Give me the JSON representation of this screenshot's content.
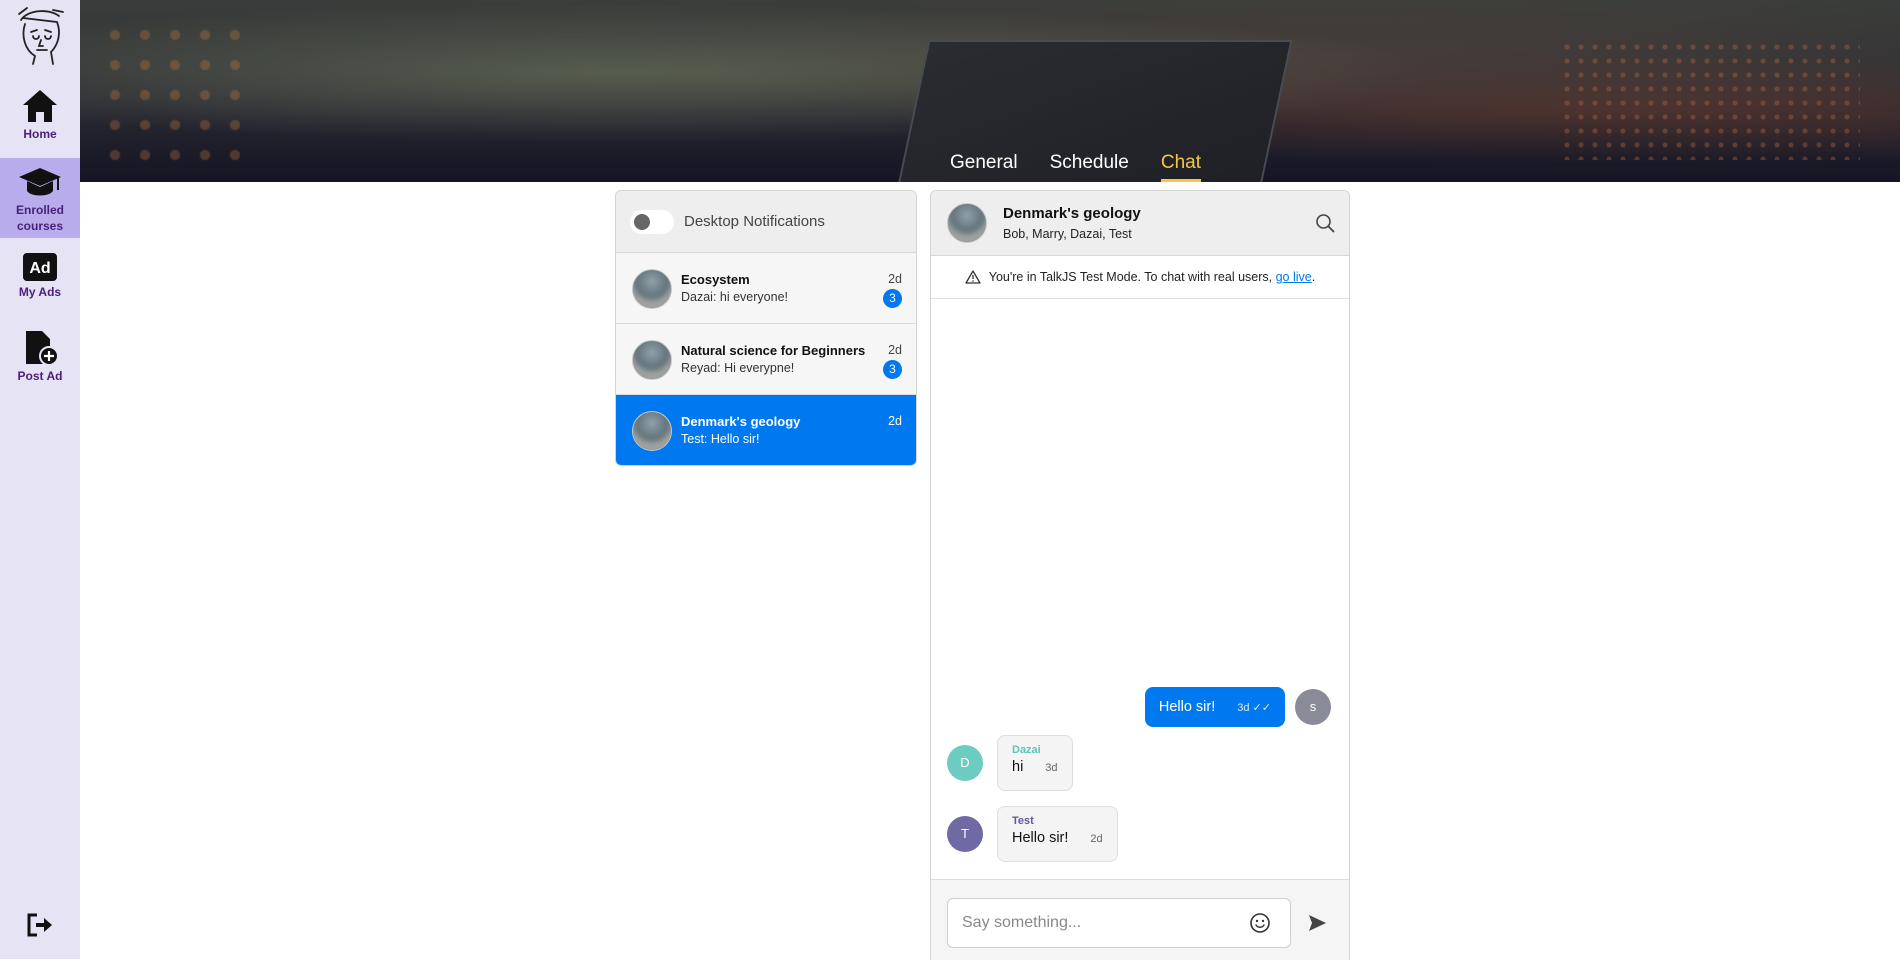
{
  "sidebar": {
    "items": [
      {
        "label": "Home",
        "icon": "home-icon"
      },
      {
        "label_line1": "Enrolled",
        "label_line2": "courses",
        "icon": "graduation-cap-icon"
      },
      {
        "label": "My Ads",
        "icon": "ad-icon"
      },
      {
        "label": "Post Ad",
        "icon": "file-plus-icon"
      }
    ],
    "ad_icon_text": "Ad",
    "active_color": "#b8acec",
    "text_color": "#4a1f7a"
  },
  "tabs": [
    {
      "label": "General"
    },
    {
      "label": "Schedule"
    },
    {
      "label": "Chat",
      "active": true
    }
  ],
  "tab_active_color": "#f2c744",
  "inbox": {
    "notifications_label": "Desktop Notifications",
    "conversations": [
      {
        "title": "Ecosystem",
        "last": "Dazai: hi everyone!",
        "time": "2d",
        "unread": "3"
      },
      {
        "title": "Natural science for Beginners",
        "last": "Reyad: Hi everypne!",
        "time": "2d",
        "unread": "3"
      },
      {
        "title": "Denmark's geology",
        "last": "Test: Hello sir!",
        "time": "2d",
        "selected": true
      }
    ]
  },
  "chat": {
    "title": "Denmark's geology",
    "participants": "Bob, Marry, Dazai, Test",
    "test_mode_text": "You're in TalkJS Test Mode. To chat with real users, ",
    "test_mode_link": "go live",
    "test_mode_period": ".",
    "messages": [
      {
        "direction": "out",
        "text": "Hello sir!",
        "meta": "3d ✓✓",
        "avatar_letter": "s",
        "avatar_color": "#8a8b99"
      },
      {
        "direction": "in",
        "sender": "Dazai",
        "text": "hi",
        "meta": "3d",
        "avatar_letter": "D",
        "avatar_color": "#6cccc1",
        "sender_color": "#5ec4b8"
      },
      {
        "direction": "in",
        "sender": "Test",
        "text": "Hello sir!",
        "meta": "2d",
        "avatar_letter": "T",
        "avatar_color": "#6f6aa3",
        "sender_color": "#5e5a94"
      }
    ],
    "composer_placeholder": "Say something..."
  },
  "accent": "#0078f0"
}
